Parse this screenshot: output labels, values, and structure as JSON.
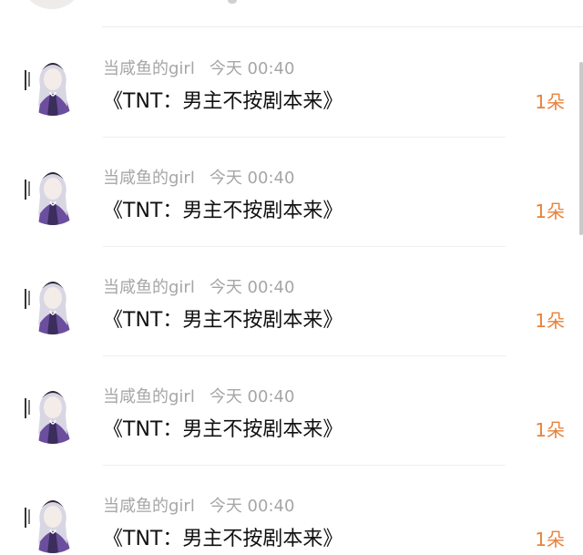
{
  "comments": [
    {
      "user": "当咸鱼的girl",
      "time": "今天 00:40",
      "text": "《TNT：男主不按剧本来》",
      "gift": "1朵"
    },
    {
      "user": "当咸鱼的girl",
      "time": "今天 00:40",
      "text": "《TNT：男主不按剧本来》",
      "gift": "1朵"
    },
    {
      "user": "当咸鱼的girl",
      "time": "今天 00:40",
      "text": "《TNT：男主不按剧本来》",
      "gift": "1朵"
    },
    {
      "user": "当咸鱼的girl",
      "time": "今天 00:40",
      "text": "《TNT：男主不按剧本来》",
      "gift": "1朵"
    },
    {
      "user": "当咸鱼的girl",
      "time": "今天 00:40",
      "text": "《TNT：男主不按剧本来》",
      "gift": "1朵"
    }
  ],
  "colors": {
    "name": "#a6a6a6",
    "title": "#111111",
    "gift": "#e8823a",
    "avatar_robe": "#6b4f9e"
  }
}
